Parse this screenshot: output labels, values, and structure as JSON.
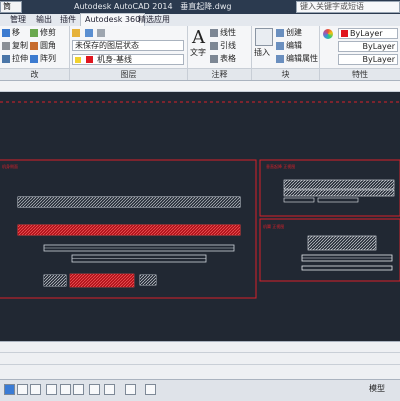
{
  "titlebar": {
    "workspace": "草图与注释",
    "workspace_short": "筒",
    "app_title": "Autodesk AutoCAD 2014",
    "file_name": "垂直起降.dwg",
    "search_placeholder": "键入关键字或短语"
  },
  "tabs": [
    "管理",
    "输出",
    "插件",
    "Autodesk 360",
    "精选应用"
  ],
  "ribbon": {
    "modify": {
      "row1": [
        "移",
        "修剪"
      ],
      "row2": [
        "复制",
        "圆角"
      ],
      "row3": [
        "拉伸",
        "阵列"
      ],
      "label": "改"
    },
    "layers": {
      "row1": "未保存的图层状态",
      "row2": "机身-基线",
      "label": "图层"
    },
    "annotation": {
      "text_label": "文字",
      "linear": "线性",
      "leader": "引线",
      "table": "表格",
      "label": "注释"
    },
    "block": {
      "insert": "插入",
      "create": "创建",
      "edit": "编辑",
      "edit_attr": "编辑属性",
      "label": "块"
    },
    "properties": {
      "color": "ByLayer",
      "linetype": "ByLayer",
      "lineweight": "ByLayer",
      "label": "特性"
    }
  },
  "canvas": {
    "frame_left_title": "机身侧面",
    "frame_right_top_title": "垂直起降 正视图",
    "frame_right_bottom_title": "机翼 正视图"
  },
  "statusbar": {
    "model_label": "模型"
  },
  "colors": {
    "canvas_bg": "#212833",
    "frame_red": "#d8202a",
    "ribbon_bg": "#f5f6f8",
    "titlebar_bg": "#2b3a4f",
    "red_swatch": "#e0161f"
  }
}
